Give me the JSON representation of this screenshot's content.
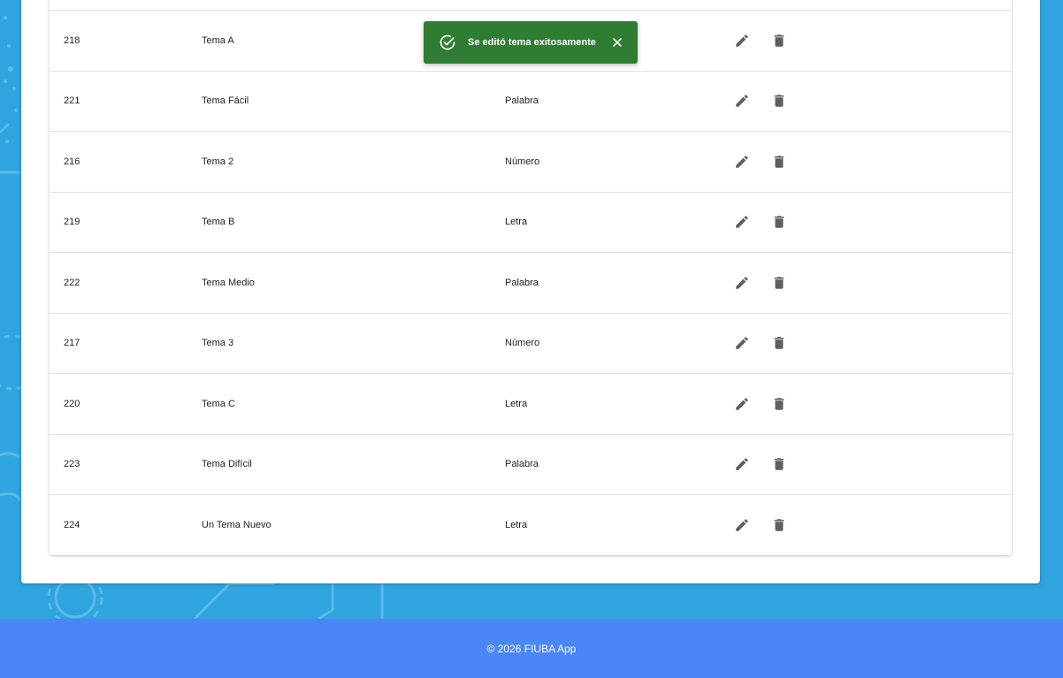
{
  "table": {
    "rows": [
      {
        "id": "218",
        "name": "Tema A",
        "type": ""
      },
      {
        "id": "221",
        "name": "Tema Fácil",
        "type": "Palabra"
      },
      {
        "id": "216",
        "name": "Tema 2",
        "type": "Número"
      },
      {
        "id": "219",
        "name": "Tema B",
        "type": "Letra"
      },
      {
        "id": "222",
        "name": "Tema Medio",
        "type": "Palabra"
      },
      {
        "id": "217",
        "name": "Tema 3",
        "type": "Número"
      },
      {
        "id": "220",
        "name": "Tema C",
        "type": "Letra"
      },
      {
        "id": "223",
        "name": "Tema Difícil",
        "type": "Palabra"
      },
      {
        "id": "224",
        "name": "Un Tema Nuevo",
        "type": "Letra"
      }
    ],
    "action_icons": [
      "pencil-icon",
      "trash-icon"
    ]
  },
  "toast": {
    "message": "Se editó tema exitosamente",
    "icon": "check-circle-icon",
    "close_icon": "close-icon",
    "color": "#2e7d32"
  },
  "footer": {
    "text": "© 2026 FIUBA App",
    "color": "#4a86f5"
  },
  "background_color": "#2fa4df"
}
